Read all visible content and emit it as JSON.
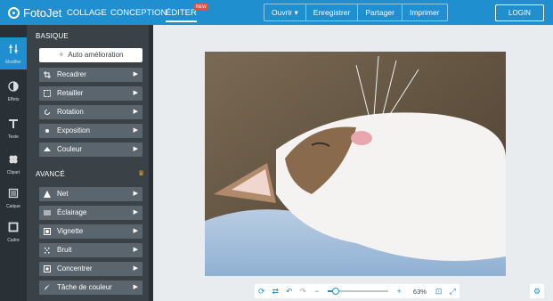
{
  "app": {
    "logo_text": "FotoJet"
  },
  "nav": {
    "items": [
      "COLLAGE",
      "CONCEPTION",
      "ÉDITER"
    ],
    "badge": "NEW"
  },
  "filebar": [
    "Ouvrir ▾",
    "Enregistrer",
    "Partager",
    "Imprimer"
  ],
  "login": "LOGIN",
  "tools": [
    {
      "label": "Modifier",
      "icon": "sliders-icon",
      "active": true
    },
    {
      "label": "Effets",
      "icon": "effects-icon"
    },
    {
      "label": "Texte",
      "icon": "text-icon"
    },
    {
      "label": "Clipart",
      "icon": "clipart-icon"
    },
    {
      "label": "Cadre",
      "icon": "frame-icon"
    },
    {
      "label": "Calque",
      "icon": "layer-icon"
    }
  ],
  "panel": {
    "basic_title": "BASIQUE",
    "auto_label": "Auto amélioration",
    "basic_items": [
      "Recadrer",
      "Retailler",
      "Rotation",
      "Exposition",
      "Couleur"
    ],
    "advanced_title": "AVANCÉ",
    "advanced_items": [
      "Net",
      "Éclairage",
      "Vignette",
      "Bruit",
      "Concentrer",
      "Tâche de couleur"
    ]
  },
  "zoom": {
    "value_label": "63%",
    "level": 0.63
  },
  "colors": {
    "accent": "#1f8fd0",
    "sidebar": "#2a3136",
    "panel": "#3a4248",
    "row": "#5a656d"
  }
}
